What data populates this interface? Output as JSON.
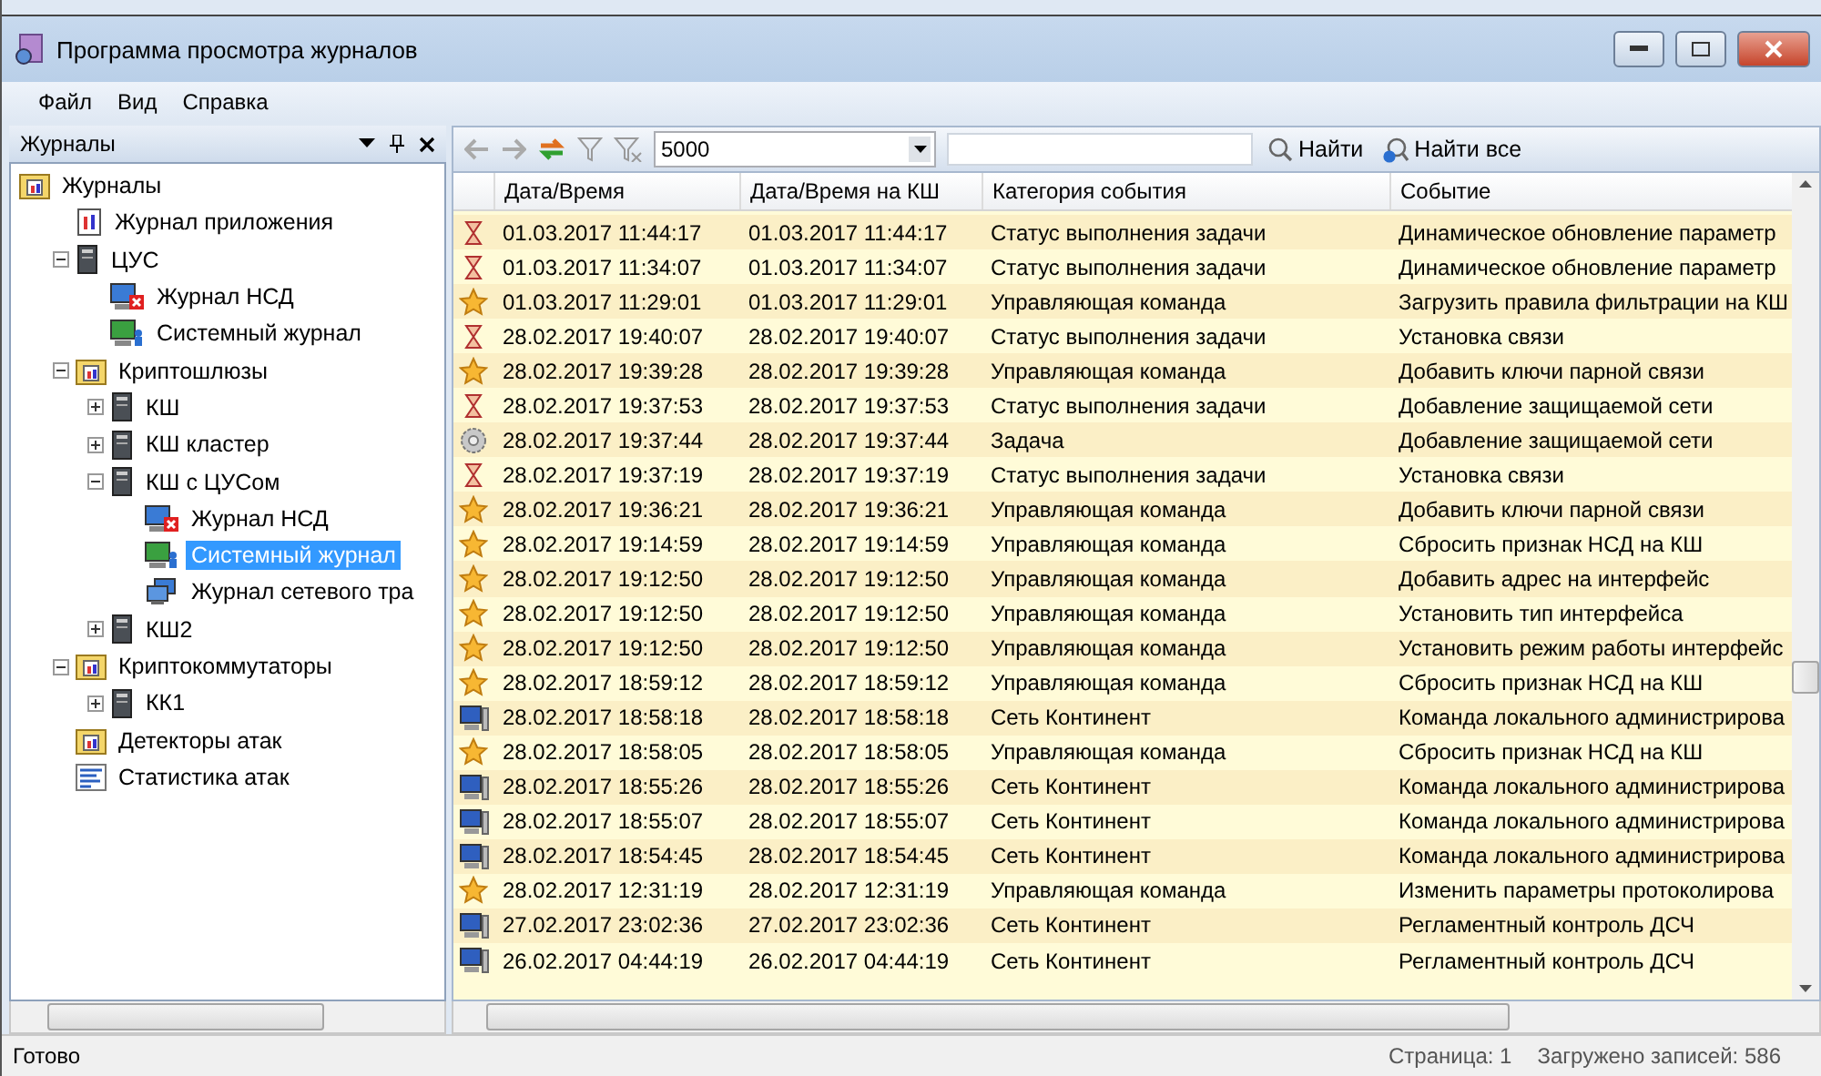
{
  "window": {
    "title": "Программа просмотра журналов"
  },
  "menu": [
    "Файл",
    "Вид",
    "Справка"
  ],
  "panel": {
    "title": "Журналы"
  },
  "tree": [
    {
      "label": "Журналы",
      "kind": "folder",
      "selected": false,
      "children": [
        {
          "label": "Журнал приложения",
          "kind": "applog",
          "selected": false
        },
        {
          "label": "ЦУС",
          "kind": "server",
          "expanded": true,
          "selected": false,
          "children": [
            {
              "label": "Журнал НСД",
              "kind": "nsd",
              "selected": false
            },
            {
              "label": "Системный журнал",
              "kind": "syslog",
              "selected": false
            }
          ]
        },
        {
          "label": "Криптошлюзы",
          "kind": "folder",
          "expanded": true,
          "selected": false,
          "children": [
            {
              "label": "КШ",
              "kind": "server",
              "expanded": false,
              "selected": false
            },
            {
              "label": "КШ кластер",
              "kind": "server",
              "expanded": false,
              "selected": false
            },
            {
              "label": "КШ с ЦУСом",
              "kind": "server",
              "expanded": true,
              "selected": false,
              "children": [
                {
                  "label": "Журнал НСД",
                  "kind": "nsd",
                  "selected": false
                },
                {
                  "label": "Системный журнал",
                  "kind": "syslog",
                  "selected": true
                },
                {
                  "label": "Журнал сетевого тра",
                  "kind": "netlog",
                  "selected": false
                }
              ]
            },
            {
              "label": "КШ2",
              "kind": "server",
              "expanded": false,
              "selected": false
            }
          ]
        },
        {
          "label": "Криптокоммутаторы",
          "kind": "folder",
          "expanded": true,
          "selected": false,
          "children": [
            {
              "label": "КК1",
              "kind": "server",
              "expanded": false,
              "selected": false
            }
          ]
        },
        {
          "label": "Детекторы атак",
          "kind": "folder",
          "selected": false
        },
        {
          "label": "Статистика атак",
          "kind": "stats",
          "selected": false
        }
      ]
    }
  ],
  "toolbar": {
    "count": "5000",
    "find": "Найти",
    "find_all": "Найти все"
  },
  "table": {
    "columns": [
      "Дата/Время",
      "Дата/Время на КШ",
      "Категория события",
      "Событие"
    ],
    "rows": [
      {
        "kind": "hourglass",
        "cells": [
          "01.03.2017 11:44:17",
          "01.03.2017 11:44:17",
          "Статус выполнения задачи",
          "Динамическое обновление параметр"
        ]
      },
      {
        "kind": "hourglass",
        "cells": [
          "01.03.2017 11:34:07",
          "01.03.2017 11:34:07",
          "Статус выполнения задачи",
          "Динамическое обновление параметр"
        ]
      },
      {
        "kind": "star",
        "cells": [
          "01.03.2017 11:29:01",
          "01.03.2017 11:29:01",
          "Управляющая команда",
          "Загрузить правила фильтрации на КШ"
        ]
      },
      {
        "kind": "hourglass",
        "cells": [
          "28.02.2017 19:40:07",
          "28.02.2017 19:40:07",
          "Статус выполнения задачи",
          "Установка связи"
        ]
      },
      {
        "kind": "star",
        "cells": [
          "28.02.2017 19:39:28",
          "28.02.2017 19:39:28",
          "Управляющая команда",
          "Добавить ключи парной связи"
        ]
      },
      {
        "kind": "hourglass",
        "cells": [
          "28.02.2017 19:37:53",
          "28.02.2017 19:37:53",
          "Статус выполнения задачи",
          "Добавление защищаемой сети"
        ]
      },
      {
        "kind": "gear",
        "cells": [
          "28.02.2017 19:37:44",
          "28.02.2017 19:37:44",
          "Задача",
          "Добавление защищаемой сети"
        ]
      },
      {
        "kind": "hourglass",
        "cells": [
          "28.02.2017 19:37:19",
          "28.02.2017 19:37:19",
          "Статус выполнения задачи",
          "Установка связи"
        ]
      },
      {
        "kind": "star",
        "cells": [
          "28.02.2017 19:36:21",
          "28.02.2017 19:36:21",
          "Управляющая команда",
          "Добавить ключи парной связи"
        ]
      },
      {
        "kind": "star",
        "cells": [
          "28.02.2017 19:14:59",
          "28.02.2017 19:14:59",
          "Управляющая команда",
          "Сбросить признак НСД на КШ"
        ]
      },
      {
        "kind": "star",
        "cells": [
          "28.02.2017 19:12:50",
          "28.02.2017 19:12:50",
          "Управляющая команда",
          "Добавить адрес на интерфейс"
        ]
      },
      {
        "kind": "star",
        "cells": [
          "28.02.2017 19:12:50",
          "28.02.2017 19:12:50",
          "Управляющая команда",
          "Установить тип интерфейса"
        ]
      },
      {
        "kind": "star",
        "cells": [
          "28.02.2017 19:12:50",
          "28.02.2017 19:12:50",
          "Управляющая команда",
          "Установить режим работы интерфейс"
        ]
      },
      {
        "kind": "star",
        "cells": [
          "28.02.2017 18:59:12",
          "28.02.2017 18:59:12",
          "Управляющая команда",
          "Сбросить признак НСД на КШ"
        ]
      },
      {
        "kind": "computer",
        "cells": [
          "28.02.2017 18:58:18",
          "28.02.2017 18:58:18",
          "Сеть Континент",
          "Команда локального администрирова"
        ]
      },
      {
        "kind": "star",
        "cells": [
          "28.02.2017 18:58:05",
          "28.02.2017 18:58:05",
          "Управляющая команда",
          "Сбросить признак НСД на КШ"
        ]
      },
      {
        "kind": "computer",
        "cells": [
          "28.02.2017 18:55:26",
          "28.02.2017 18:55:26",
          "Сеть Континент",
          "Команда локального администрирова"
        ]
      },
      {
        "kind": "computer",
        "cells": [
          "28.02.2017 18:55:07",
          "28.02.2017 18:55:07",
          "Сеть Континент",
          "Команда локального администрирова"
        ]
      },
      {
        "kind": "computer",
        "cells": [
          "28.02.2017 18:54:45",
          "28.02.2017 18:54:45",
          "Сеть Континент",
          "Команда локального администрирова"
        ]
      },
      {
        "kind": "star",
        "cells": [
          "28.02.2017 12:31:19",
          "28.02.2017 12:31:19",
          "Управляющая команда",
          "Изменить параметры протоколирова"
        ]
      },
      {
        "kind": "computer",
        "cells": [
          "27.02.2017 23:02:36",
          "27.02.2017 23:02:36",
          "Сеть Континент",
          "Регламентный контроль ДСЧ"
        ]
      },
      {
        "kind": "computer",
        "cells": [
          "26.02.2017 04:44:19",
          "26.02.2017 04:44:19",
          "Сеть Континент",
          "Регламентный контроль ДСЧ"
        ]
      }
    ]
  },
  "status_bar": {
    "left": "Готово",
    "page": "Страница: 1",
    "loaded": "Загружено записей: 586"
  }
}
